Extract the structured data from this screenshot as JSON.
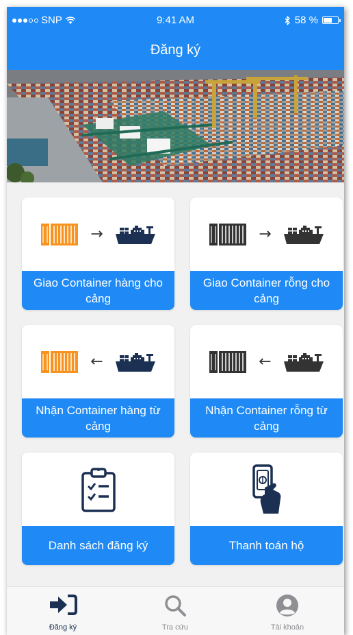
{
  "status_bar": {
    "carrier": "SNP",
    "time": "9:41 AM",
    "battery": "58 %"
  },
  "header": {
    "title": "Đăng ký"
  },
  "hero_image": {
    "description": "container-port"
  },
  "cards": [
    {
      "label": "Giao Container hàng cho cảng",
      "icon": "full-container-to-ship",
      "container_color": "#f7931e",
      "arrow": "→"
    },
    {
      "label": "Giao Container rỗng cho cảng",
      "icon": "empty-container-to-ship",
      "container_color": "#333333",
      "arrow": "→"
    },
    {
      "label": "Nhận Container hàng từ cảng",
      "icon": "full-container-from-ship",
      "container_color": "#f7931e",
      "arrow": "←"
    },
    {
      "label": "Nhận Container rỗng từ cảng",
      "icon": "empty-container-from-ship",
      "container_color": "#333333",
      "arrow": "←"
    },
    {
      "label": "Danh sách đăng ký",
      "icon": "clipboard-checklist-icon"
    },
    {
      "label": "Thanh toán hộ",
      "icon": "phone-payment-icon"
    }
  ],
  "tab_bar": {
    "items": [
      {
        "label": "Đăng ký",
        "icon": "sign-in-icon",
        "active": true
      },
      {
        "label": "Tra cứu",
        "icon": "search-icon",
        "active": false
      },
      {
        "label": "Tài khoản",
        "icon": "account-icon",
        "active": false
      }
    ]
  },
  "colors": {
    "primary": "#1f8af5",
    "active_tab": "#1b3052",
    "inactive_tab": "#8e8e93",
    "full_container": "#f7931e",
    "empty_container": "#333333",
    "ship": "#1b3052"
  }
}
